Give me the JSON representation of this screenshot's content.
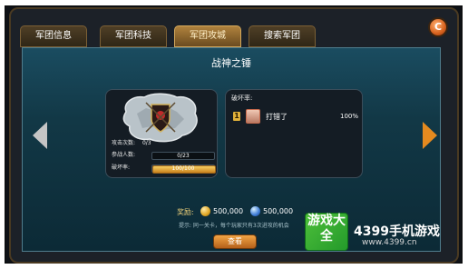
{
  "tabs": [
    {
      "label": "军团信息"
    },
    {
      "label": "军团科技"
    },
    {
      "label": "军团攻城"
    },
    {
      "label": "搜索军团"
    }
  ],
  "close_glyph": "C",
  "title": "战神之锤",
  "stats": {
    "attacks_label": "攻击次数:",
    "attacks_value": "0/3",
    "participants_label": "参战人数:",
    "participants_value": "0/23",
    "damage_label": "破坏率:",
    "damage_value": "100/100",
    "damage_progress": 1.0
  },
  "damage_panel": {
    "heading": "破坏率:",
    "rank": "1",
    "player_name": "打错了",
    "percent": "100%"
  },
  "reward": {
    "label": "奖励:",
    "coins": "500,000",
    "gems": "500,000",
    "hint": "提示: 同一关卡，每个玩家只有3次进攻的机会"
  },
  "view_button": "查看",
  "watermark": {
    "badge": "游戏大全",
    "text": "4399手机游戏",
    "url": "www.4399.cn"
  },
  "icons": {
    "left_arrow": "arrow-left-icon",
    "right_arrow": "arrow-right-icon",
    "coin": "gold-coin-icon",
    "gem": "gem-icon",
    "shield": "shield-emblem-icon",
    "close": "refresh-close-icon"
  },
  "colors": {
    "accent_gold": "#d4a85b",
    "content_teal": "#1a4c60",
    "next_arrow": "#e58a1f"
  }
}
